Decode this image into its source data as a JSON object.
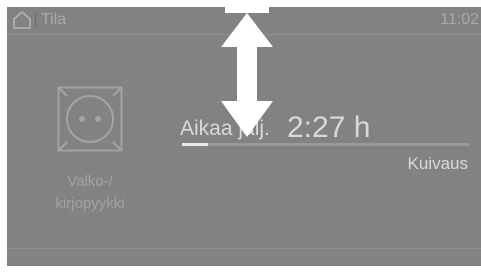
{
  "header": {
    "title": "Tila",
    "time": "11:02"
  },
  "program": {
    "name_line1": "Valko-/",
    "name_line2": "kirjopyykki",
    "icon": "cotton-program-icon"
  },
  "status": {
    "remaining_label": "Aikaa jälj.",
    "remaining_time": "2:27 h",
    "phase": "Kuivaus",
    "progress": 0.09
  },
  "icons": {
    "home": "home-icon",
    "scroll": "vertical-scroll-arrow-icon"
  },
  "colors": {
    "screen_background": "#828282",
    "text_active": "#d9d9d9",
    "text_dimmed": "#a3a3a3",
    "arrow": "#ffffff"
  }
}
